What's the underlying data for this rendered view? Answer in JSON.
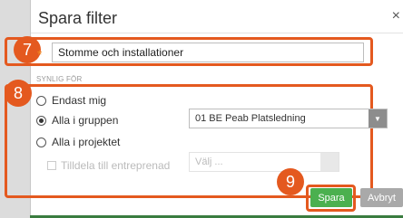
{
  "dialog": {
    "title": "Spara filter",
    "close_glyph": "×"
  },
  "name_field": {
    "required_mark": "*",
    "value": "Stomme och installationer"
  },
  "visibility": {
    "section_label": "SYNLIG FÖR",
    "options": [
      {
        "label": "Endast mig",
        "checked": false
      },
      {
        "label": "Alla i gruppen",
        "checked": true
      },
      {
        "label": "Alla i projektet",
        "checked": false
      }
    ],
    "group_select_value": "01 BE Peab Platsledning",
    "assign_checkbox_label": "Tilldela till entreprenad",
    "contractor_select_placeholder": "Välj ..."
  },
  "buttons": {
    "save": "Spara",
    "cancel": "Avbryt"
  },
  "badges": {
    "name_field": "7",
    "visibility": "8",
    "save": "9"
  },
  "colors": {
    "highlight": "#e4591f",
    "save_button": "#4bb04f",
    "cancel_button": "#a9a9a9",
    "required_star": "#f08a24"
  }
}
